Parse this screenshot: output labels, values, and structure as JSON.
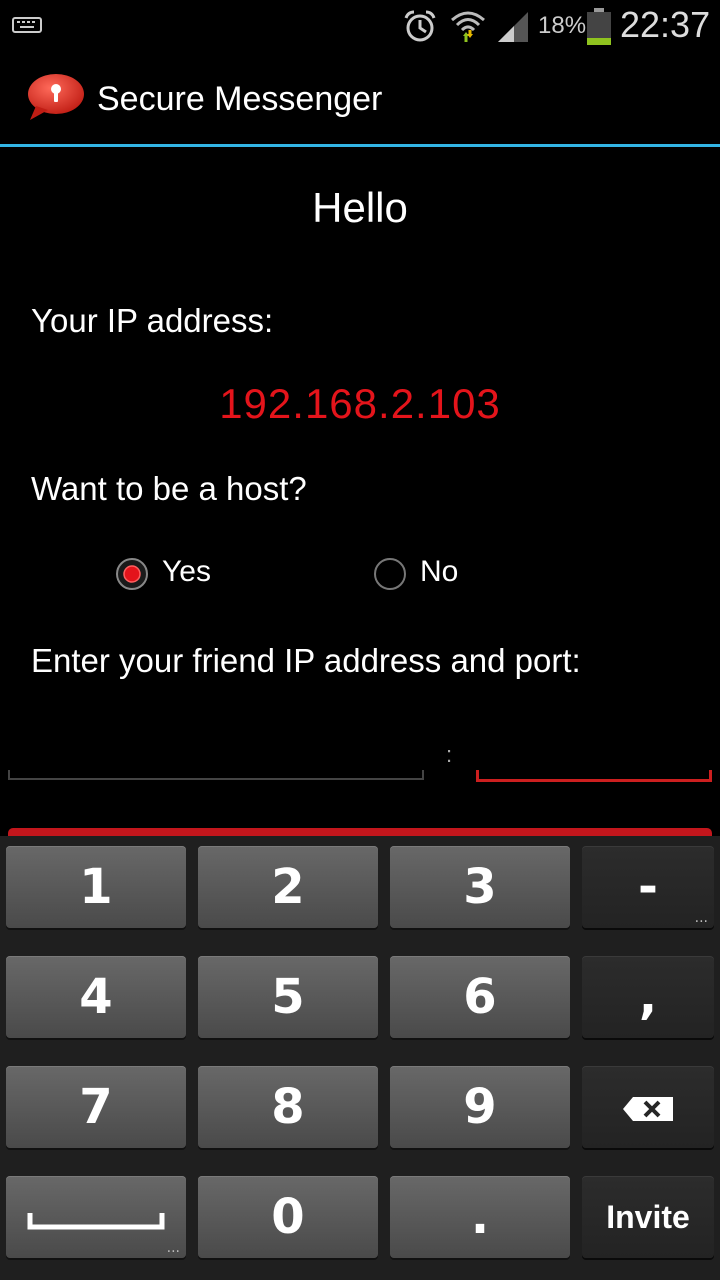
{
  "status_bar": {
    "battery_percent": "18%",
    "time": "22:37",
    "icons": [
      "keyboard-icon",
      "alarm-icon",
      "wifi-icon",
      "signal-icon",
      "battery-icon"
    ]
  },
  "action_bar": {
    "title": "Secure Messenger",
    "icon": "secure-messenger-logo-icon",
    "divider_color": "#33b5e5"
  },
  "main": {
    "greeting": "Hello",
    "ip_label": "Your IP address:",
    "ip_value": "192.168.2.103",
    "ip_color": "#e4141b",
    "host_question": "Want to be a host?",
    "radio_options": [
      {
        "label": "Yes",
        "selected": true
      },
      {
        "label": "No",
        "selected": false
      }
    ],
    "friend_label": "Enter your friend IP address and port:",
    "ip_input_value": "",
    "port_separator": ":",
    "port_input_value": ""
  },
  "keyboard": {
    "rows": [
      [
        "1",
        "2",
        "3",
        "-"
      ],
      [
        "4",
        "5",
        "6",
        ","
      ],
      [
        "7",
        "8",
        "9",
        "backspace"
      ],
      [
        "space",
        "0",
        ".",
        "Invite"
      ]
    ],
    "labels": {
      "k1": "1",
      "k2": "2",
      "k3": "3",
      "kminus": "-",
      "k4": "4",
      "k5": "5",
      "k6": "6",
      "kcomma": ",",
      "k7": "7",
      "k8": "8",
      "k9": "9",
      "k0": "0",
      "kdot": ".",
      "kinvite": "Invite",
      "more": "..."
    }
  }
}
